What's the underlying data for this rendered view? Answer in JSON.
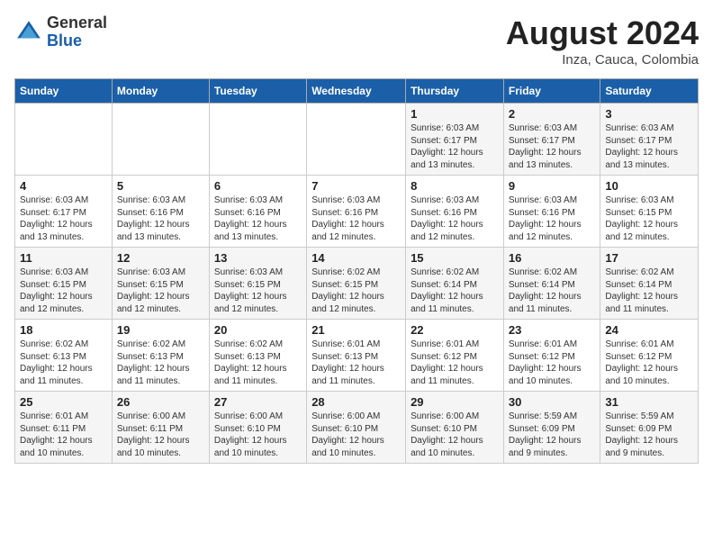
{
  "logo": {
    "general": "General",
    "blue": "Blue"
  },
  "title": "August 2024",
  "location": "Inza, Cauca, Colombia",
  "days_of_week": [
    "Sunday",
    "Monday",
    "Tuesday",
    "Wednesday",
    "Thursday",
    "Friday",
    "Saturday"
  ],
  "weeks": [
    [
      {
        "day": "",
        "info": ""
      },
      {
        "day": "",
        "info": ""
      },
      {
        "day": "",
        "info": ""
      },
      {
        "day": "",
        "info": ""
      },
      {
        "day": "1",
        "info": "Sunrise: 6:03 AM\nSunset: 6:17 PM\nDaylight: 12 hours\nand 13 minutes."
      },
      {
        "day": "2",
        "info": "Sunrise: 6:03 AM\nSunset: 6:17 PM\nDaylight: 12 hours\nand 13 minutes."
      },
      {
        "day": "3",
        "info": "Sunrise: 6:03 AM\nSunset: 6:17 PM\nDaylight: 12 hours\nand 13 minutes."
      }
    ],
    [
      {
        "day": "4",
        "info": "Sunrise: 6:03 AM\nSunset: 6:17 PM\nDaylight: 12 hours\nand 13 minutes."
      },
      {
        "day": "5",
        "info": "Sunrise: 6:03 AM\nSunset: 6:16 PM\nDaylight: 12 hours\nand 13 minutes."
      },
      {
        "day": "6",
        "info": "Sunrise: 6:03 AM\nSunset: 6:16 PM\nDaylight: 12 hours\nand 13 minutes."
      },
      {
        "day": "7",
        "info": "Sunrise: 6:03 AM\nSunset: 6:16 PM\nDaylight: 12 hours\nand 12 minutes."
      },
      {
        "day": "8",
        "info": "Sunrise: 6:03 AM\nSunset: 6:16 PM\nDaylight: 12 hours\nand 12 minutes."
      },
      {
        "day": "9",
        "info": "Sunrise: 6:03 AM\nSunset: 6:16 PM\nDaylight: 12 hours\nand 12 minutes."
      },
      {
        "day": "10",
        "info": "Sunrise: 6:03 AM\nSunset: 6:15 PM\nDaylight: 12 hours\nand 12 minutes."
      }
    ],
    [
      {
        "day": "11",
        "info": "Sunrise: 6:03 AM\nSunset: 6:15 PM\nDaylight: 12 hours\nand 12 minutes."
      },
      {
        "day": "12",
        "info": "Sunrise: 6:03 AM\nSunset: 6:15 PM\nDaylight: 12 hours\nand 12 minutes."
      },
      {
        "day": "13",
        "info": "Sunrise: 6:03 AM\nSunset: 6:15 PM\nDaylight: 12 hours\nand 12 minutes."
      },
      {
        "day": "14",
        "info": "Sunrise: 6:02 AM\nSunset: 6:15 PM\nDaylight: 12 hours\nand 12 minutes."
      },
      {
        "day": "15",
        "info": "Sunrise: 6:02 AM\nSunset: 6:14 PM\nDaylight: 12 hours\nand 11 minutes."
      },
      {
        "day": "16",
        "info": "Sunrise: 6:02 AM\nSunset: 6:14 PM\nDaylight: 12 hours\nand 11 minutes."
      },
      {
        "day": "17",
        "info": "Sunrise: 6:02 AM\nSunset: 6:14 PM\nDaylight: 12 hours\nand 11 minutes."
      }
    ],
    [
      {
        "day": "18",
        "info": "Sunrise: 6:02 AM\nSunset: 6:13 PM\nDaylight: 12 hours\nand 11 minutes."
      },
      {
        "day": "19",
        "info": "Sunrise: 6:02 AM\nSunset: 6:13 PM\nDaylight: 12 hours\nand 11 minutes."
      },
      {
        "day": "20",
        "info": "Sunrise: 6:02 AM\nSunset: 6:13 PM\nDaylight: 12 hours\nand 11 minutes."
      },
      {
        "day": "21",
        "info": "Sunrise: 6:01 AM\nSunset: 6:13 PM\nDaylight: 12 hours\nand 11 minutes."
      },
      {
        "day": "22",
        "info": "Sunrise: 6:01 AM\nSunset: 6:12 PM\nDaylight: 12 hours\nand 11 minutes."
      },
      {
        "day": "23",
        "info": "Sunrise: 6:01 AM\nSunset: 6:12 PM\nDaylight: 12 hours\nand 10 minutes."
      },
      {
        "day": "24",
        "info": "Sunrise: 6:01 AM\nSunset: 6:12 PM\nDaylight: 12 hours\nand 10 minutes."
      }
    ],
    [
      {
        "day": "25",
        "info": "Sunrise: 6:01 AM\nSunset: 6:11 PM\nDaylight: 12 hours\nand 10 minutes."
      },
      {
        "day": "26",
        "info": "Sunrise: 6:00 AM\nSunset: 6:11 PM\nDaylight: 12 hours\nand 10 minutes."
      },
      {
        "day": "27",
        "info": "Sunrise: 6:00 AM\nSunset: 6:10 PM\nDaylight: 12 hours\nand 10 minutes."
      },
      {
        "day": "28",
        "info": "Sunrise: 6:00 AM\nSunset: 6:10 PM\nDaylight: 12 hours\nand 10 minutes."
      },
      {
        "day": "29",
        "info": "Sunrise: 6:00 AM\nSunset: 6:10 PM\nDaylight: 12 hours\nand 10 minutes."
      },
      {
        "day": "30",
        "info": "Sunrise: 5:59 AM\nSunset: 6:09 PM\nDaylight: 12 hours\nand 9 minutes."
      },
      {
        "day": "31",
        "info": "Sunrise: 5:59 AM\nSunset: 6:09 PM\nDaylight: 12 hours\nand 9 minutes."
      }
    ]
  ]
}
